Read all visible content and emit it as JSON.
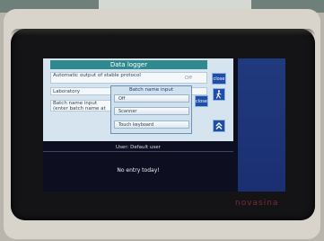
{
  "dialog": {
    "title": "Data logger",
    "close_label": "close",
    "rows": [
      {
        "label": "Automatic output of stable protocol",
        "value": "Off"
      },
      {
        "label": "Laboratory",
        "value": ""
      },
      {
        "label": "Batch name input (enter batch name at",
        "value": ""
      }
    ]
  },
  "submenu": {
    "title": "Batch name input",
    "close_label": "close",
    "options": [
      "Off",
      "Scanner",
      "Touch keyboard"
    ]
  },
  "status": {
    "user": "User: Default user",
    "message": "No entry today!"
  },
  "device": {
    "brand": "novasina"
  },
  "icons": {
    "person": "walking-person-icon",
    "scroll_up": "double-chevron-up-icon"
  }
}
